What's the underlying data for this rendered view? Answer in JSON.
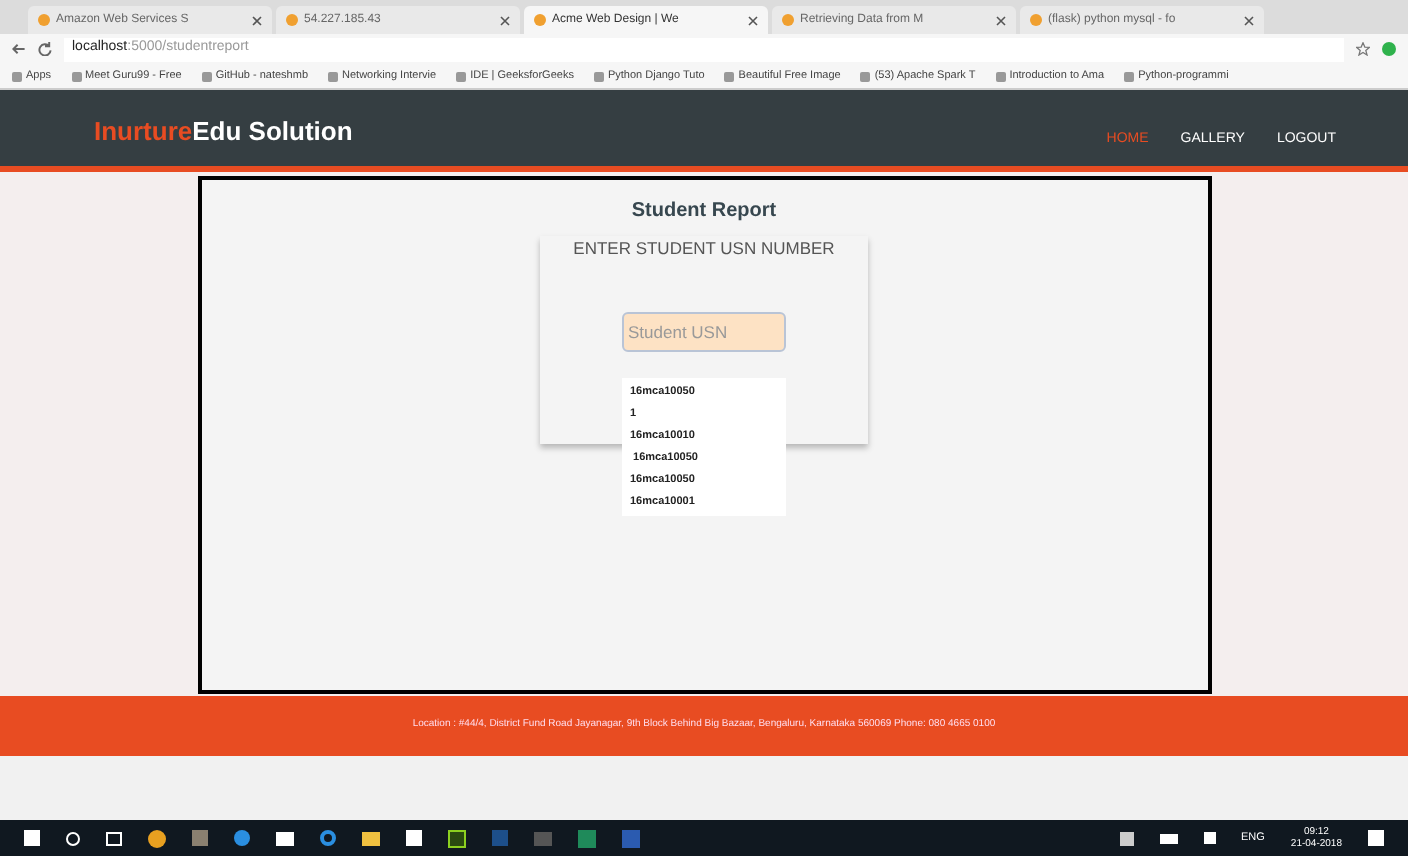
{
  "browser": {
    "tabs": [
      {
        "label": "Amazon Web Services S",
        "selected": false
      },
      {
        "label": "54.227.185.43",
        "selected": false
      },
      {
        "label": "Acme Web Design | We",
        "selected": true
      },
      {
        "label": "Retrieving Data from M",
        "selected": false
      },
      {
        "label": "(flask) python mysql - fo",
        "selected": false
      }
    ],
    "address": {
      "host": "localhost",
      "path": ":5000/studentreport"
    },
    "bookmarks": [
      "Apps",
      "Meet Guru99 - Free",
      "GitHub - nateshmb",
      "Networking Intervie",
      "IDE | GeeksforGeeks",
      "Python Django Tuto",
      "Beautiful Free Image",
      "(53) Apache Spark T",
      "Introduction to Ama",
      "Python-programmi"
    ]
  },
  "navbar": {
    "brand_accent": "Inurture",
    "brand": "Edu Solution",
    "links": [
      {
        "label": "HOME",
        "selected": true
      },
      {
        "label": "GALLERY",
        "selected": false
      },
      {
        "label": "LOGOUT",
        "selected": false
      }
    ]
  },
  "report": {
    "title": "Student Report",
    "prompt": "ENTER STUDENT USN NUMBER",
    "field": {
      "placeholder": "Student USN"
    },
    "suggestions": [
      "16mca10050",
      "1",
      "16mca10010",
      " 16mca10050",
      "16mca10050",
      "16mca10001"
    ]
  },
  "footer": {
    "text": "Location : #44/4, District Fund Road Jayanagar, 9th Block Behind Big Bazaar, Bengaluru, Karnataka 560069 Phone: 080 4665 0100"
  },
  "taskbar": {
    "language": "ENG",
    "time": "09:12",
    "date": "21-04-2018"
  }
}
